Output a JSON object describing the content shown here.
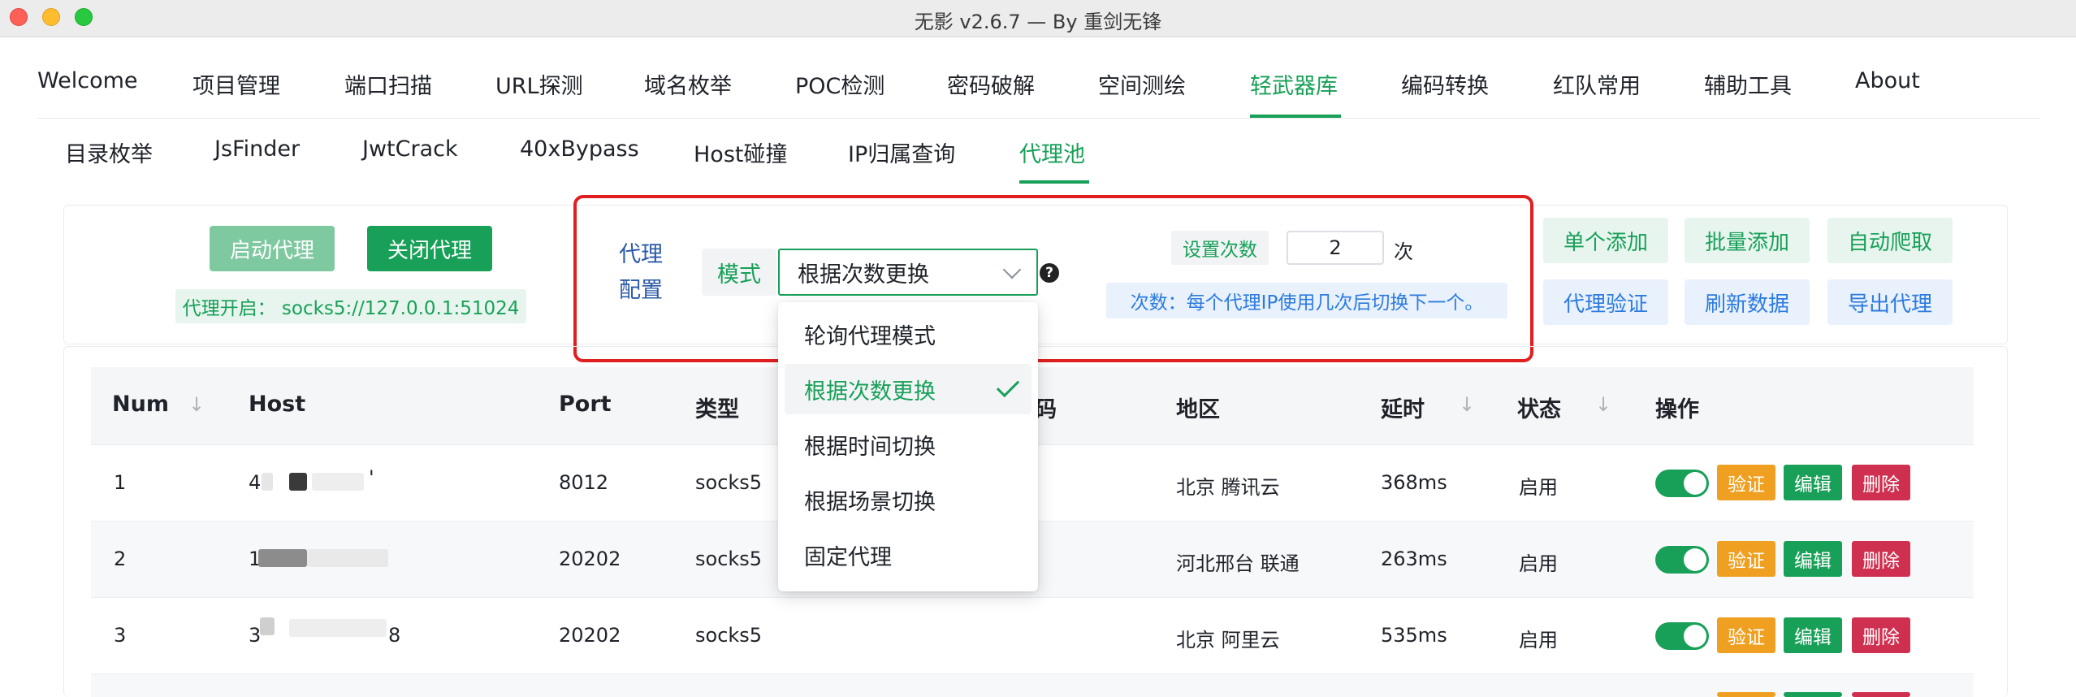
{
  "window": {
    "title": "无影 v2.6.7 — By 重剑无锋"
  },
  "main_tabs": [
    "Welcome",
    "项目管理",
    "端口扫描",
    "URL探测",
    "域名枚举",
    "POC检测",
    "密码破解",
    "空间测绘",
    "轻武器库",
    "编码转换",
    "红队常用",
    "辅助工具",
    "About"
  ],
  "main_active": "轻武器库",
  "sub_tabs": [
    "目录枚举",
    "JsFinder",
    "JwtCrack",
    "40xBypass",
    "Host碰撞",
    "IP归属查询",
    "代理池"
  ],
  "sub_active": "代理池",
  "proxy": {
    "start_label": "启动代理",
    "stop_label": "关闭代理",
    "status_text": "代理开启： socks5://127.0.0.1:51024"
  },
  "config": {
    "label": "代理配置",
    "mode_label": "模式",
    "mode_value": "根据次数更换",
    "help": "?",
    "times_label": "设置次数",
    "times_value": "2",
    "times_unit": "次",
    "times_hint": "次数：每个代理IP使用几次后切换下一个。"
  },
  "actions": {
    "single_add": "单个添加",
    "batch_add": "批量添加",
    "auto_crawl": "自动爬取",
    "verify_proxy": "代理验证",
    "refresh_data": "刷新数据",
    "export_proxy": "导出代理"
  },
  "dropdown": {
    "options": [
      "轮询代理模式",
      "根据次数更换",
      "根据时间切换",
      "根据场景切换",
      "固定代理"
    ],
    "selected_index": 1
  },
  "table": {
    "columns": {
      "num": "Num",
      "host": "Host",
      "port": "Port",
      "type": "类型",
      "hidden_tail": "码",
      "region": "地区",
      "latency": "延时",
      "status": "状态",
      "ops": "操作"
    },
    "rows": [
      {
        "num": "1",
        "host_prefix": "4",
        "host_suffix": "'",
        "port": "8012",
        "type": "socks5",
        "region": "北京 腾讯云",
        "latency": "368ms",
        "status": "启用",
        "enabled": true
      },
      {
        "num": "2",
        "host_prefix": "1",
        "host_suffix": "",
        "port": "20202",
        "type": "socks5",
        "region": "河北邢台 联通",
        "latency": "263ms",
        "status": "启用",
        "enabled": true
      },
      {
        "num": "3",
        "host_prefix": "3",
        "host_suffix": "8",
        "port": "20202",
        "type": "socks5",
        "region": "北京 阿里云",
        "latency": "535ms",
        "status": "启用",
        "enabled": true
      }
    ],
    "row_actions": {
      "verify": "验证",
      "edit": "编辑",
      "delete": "删除"
    }
  },
  "colors": {
    "accent": "#18a058",
    "info": "#2d7be0",
    "warning": "#f0a020",
    "danger": "#d03050",
    "highlight_box": "#e02020"
  }
}
